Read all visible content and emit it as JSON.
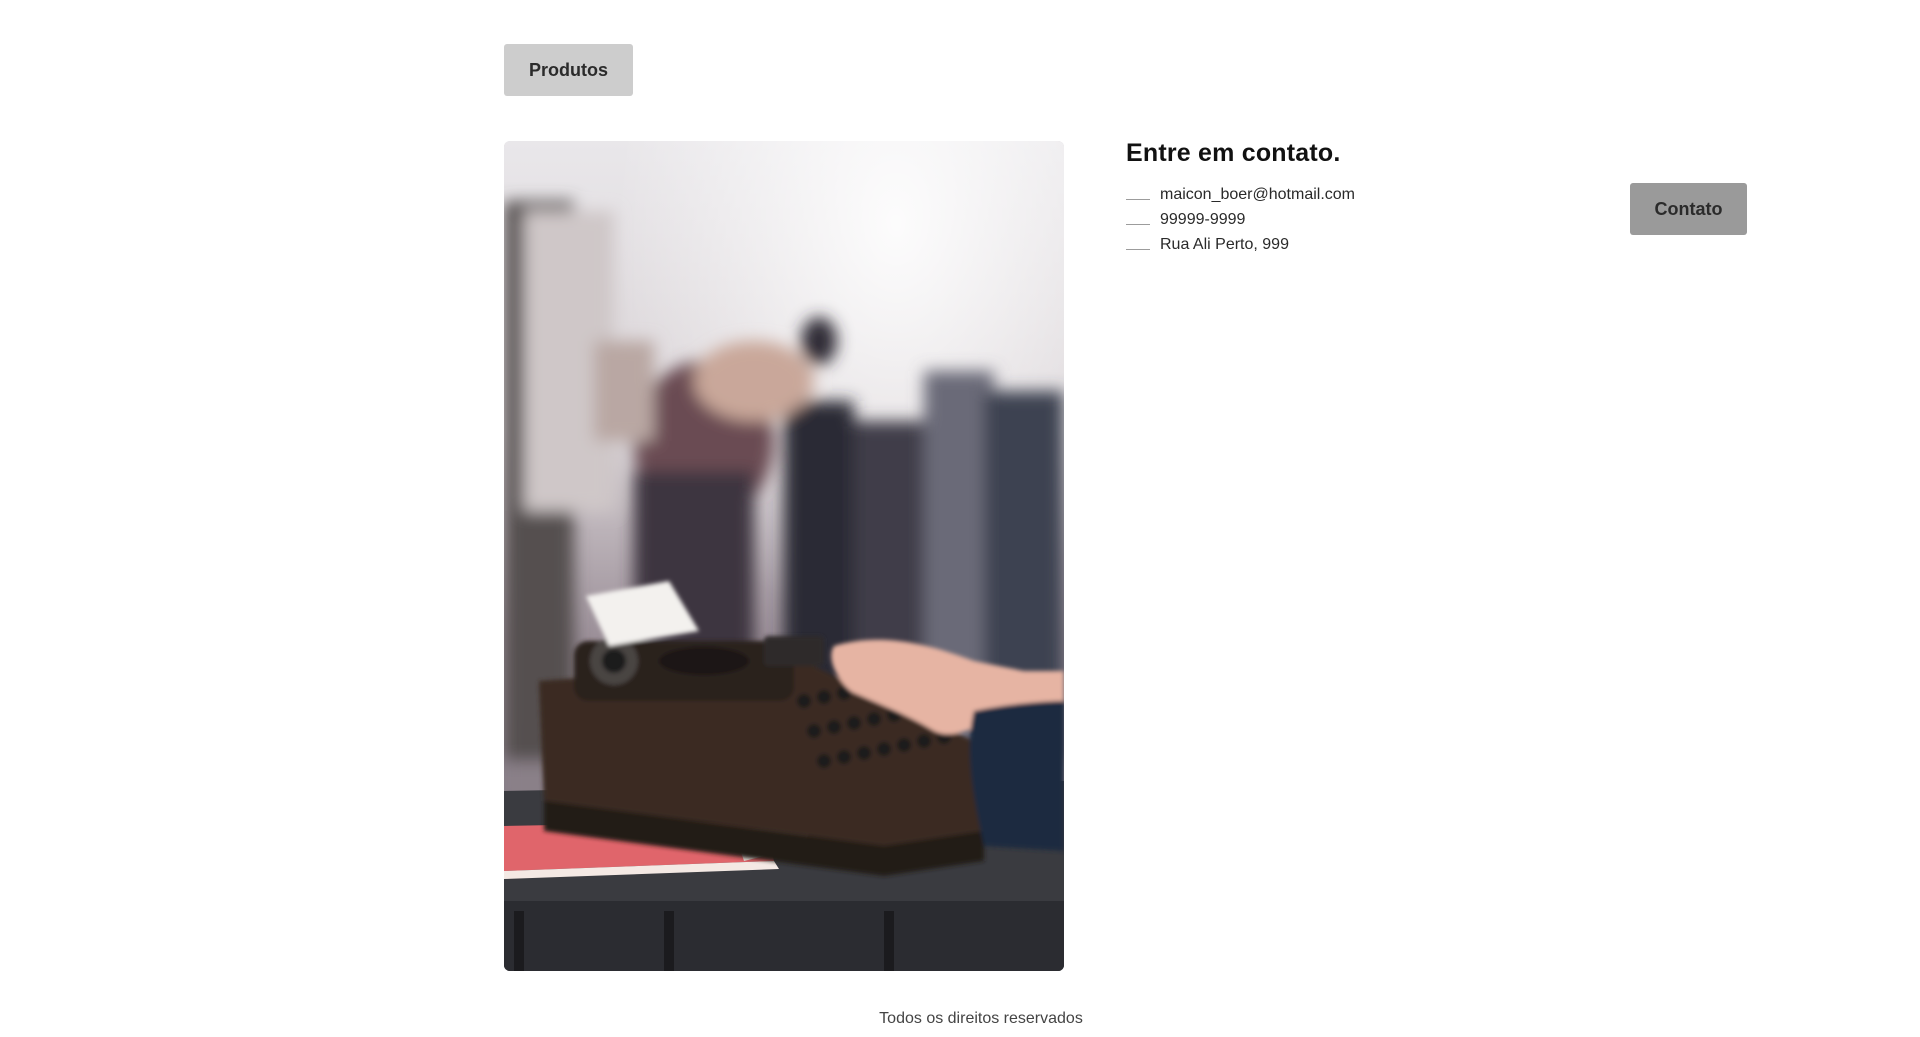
{
  "nav": {
    "products_label": "Produtos",
    "contact_label": "Contato"
  },
  "contact": {
    "title": "Entre em contato.",
    "items": [
      {
        "icon": "line-icon",
        "text": "maicon_boer@hotmail.com"
      },
      {
        "icon": "line-icon",
        "text": "99999-9999"
      },
      {
        "icon": "line-icon",
        "text": "Rua Ali Perto, 999"
      }
    ]
  },
  "photo": {
    "subject": "typewriter-photo"
  },
  "footer": {
    "text": "Todos os direitos reservados"
  },
  "colors": {
    "products_button_bg": "#cdcdcd",
    "contact_button_bg": "#9a9a9a",
    "page_bg": "#ffffff"
  }
}
